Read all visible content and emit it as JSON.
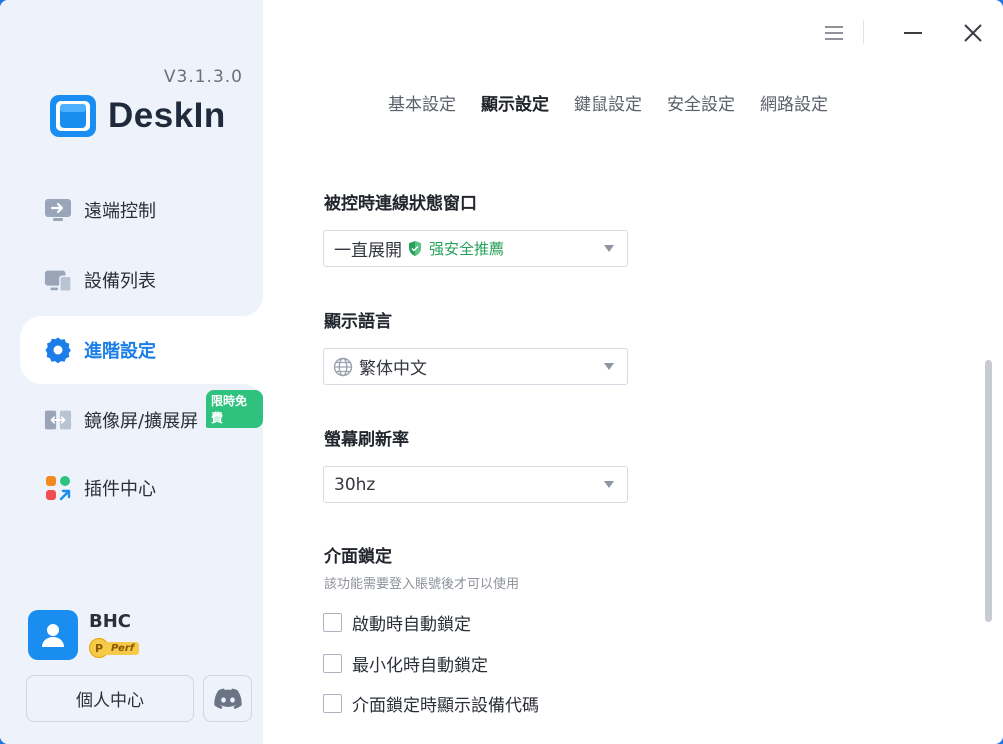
{
  "app": {
    "name": "DeskIn",
    "version": "V3.1.3.0"
  },
  "sidebar": {
    "items": [
      {
        "label": "遠端控制",
        "icon": "remote-control-icon"
      },
      {
        "label": "設備列表",
        "icon": "device-list-icon"
      },
      {
        "label": "進階設定",
        "icon": "gear-icon",
        "active": true
      },
      {
        "label": "鏡像屏/擴展屏",
        "icon": "mirror-screen-icon"
      },
      {
        "label": "插件中心",
        "icon": "plugin-icon"
      }
    ],
    "free_badge": "限時免費"
  },
  "user": {
    "name": "BHC",
    "badge_letter": "P",
    "badge_text": "Perf",
    "personal_center": "個人中心"
  },
  "tabs": [
    {
      "label": "基本設定",
      "active": false
    },
    {
      "label": "顯示設定",
      "active": true
    },
    {
      "label": "鍵鼠設定",
      "active": false
    },
    {
      "label": "安全設定",
      "active": false
    },
    {
      "label": "網路設定",
      "active": false
    }
  ],
  "settings": {
    "status_window": {
      "title": "被控時連線狀態窗口",
      "value": "一直展開",
      "recommend": "强安全推薦"
    },
    "language": {
      "title": "顯示語言",
      "value": "繁体中文"
    },
    "refresh_rate": {
      "title": "螢幕刷新率",
      "value": "30hz"
    },
    "interface_lock": {
      "title": "介面鎖定",
      "hint": "該功能需要登入賬號後才可以使用",
      "options": [
        {
          "label": "啟動時自動鎖定",
          "checked": false
        },
        {
          "label": "最小化時自動鎖定",
          "checked": false
        },
        {
          "label": "介面鎖定時顯示設備代碼",
          "checked": false
        }
      ]
    }
  },
  "colors": {
    "accent": "#1a7de8",
    "sidebar_bg": "#eef3fb",
    "recommend_green": "#27a05a",
    "badge_green": "#2ec27e"
  }
}
